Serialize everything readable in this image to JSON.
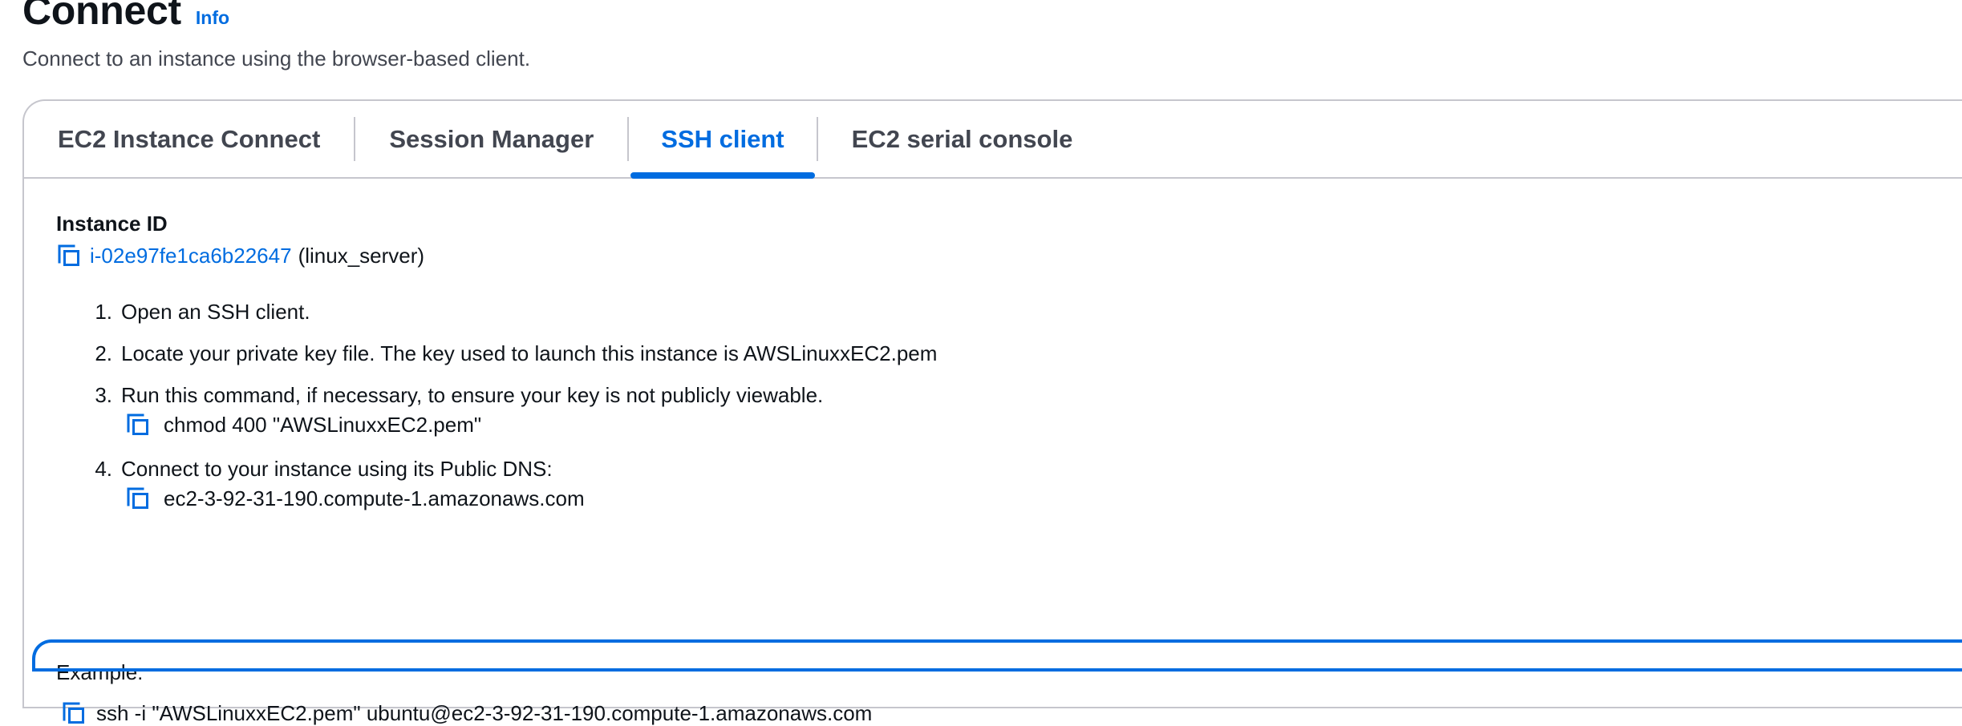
{
  "header": {
    "title": "Connect",
    "info_label": "Info",
    "description": "Connect to an instance using the browser-based client."
  },
  "tabs": [
    {
      "label": "EC2 Instance Connect",
      "active": false
    },
    {
      "label": "Session Manager",
      "active": false
    },
    {
      "label": "SSH client",
      "active": true
    },
    {
      "label": "EC2 serial console",
      "active": false
    }
  ],
  "instance": {
    "label": "Instance ID",
    "id": "i-02e97fe1ca6b22647",
    "name": "(linux_server)"
  },
  "steps": [
    {
      "num": "1.",
      "text": "Open an SSH client."
    },
    {
      "num": "2.",
      "text": "Locate your private key file. The key used to launch this instance is AWSLinuxxEC2.pem"
    },
    {
      "num": "3.",
      "text": "Run this command, if necessary, to ensure your key is not publicly viewable.",
      "command": "chmod 400 \"AWSLinuxxEC2.pem\""
    },
    {
      "num": "4.",
      "text": "Connect to your instance using its Public DNS:",
      "command": "ec2-3-92-31-190.compute-1.amazonaws.com"
    }
  ],
  "example": {
    "label": "Example:",
    "command": "ssh -i \"AWSLinuxxEC2.pem\" ubuntu@ec2-3-92-31-190.compute-1.amazonaws.com"
  },
  "colors": {
    "accent": "#006ce0",
    "text": "#0f141a",
    "muted": "#424650",
    "border": "#c6c6cd"
  },
  "icons": {
    "copy": "copy-icon"
  }
}
